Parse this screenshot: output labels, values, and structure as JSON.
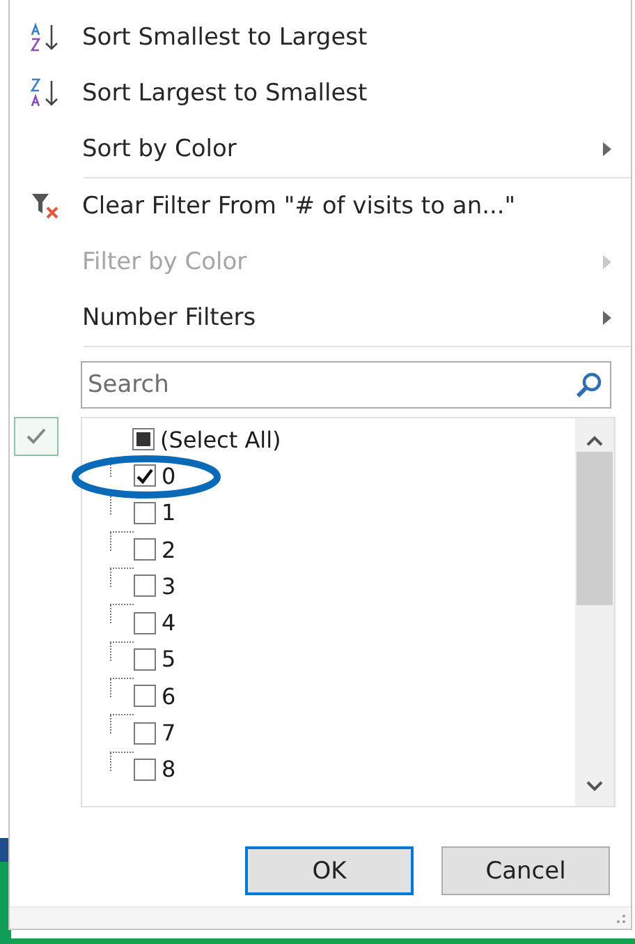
{
  "menu": [
    {
      "kind": "sort_asc",
      "label": "Sort Smallest to Largest",
      "disabled": false,
      "submenu": false
    },
    {
      "kind": "sort_desc",
      "label": "Sort Largest to Smallest",
      "disabled": false,
      "submenu": false
    },
    {
      "kind": "plain",
      "label": "Sort by Color",
      "disabled": false,
      "submenu": true,
      "separator_after": true
    },
    {
      "kind": "clear_filter",
      "label": "Clear Filter From \"# of visits to an...\"",
      "disabled": false,
      "submenu": false
    },
    {
      "kind": "plain",
      "label": "Filter by Color",
      "disabled": true,
      "submenu": true
    },
    {
      "kind": "plain",
      "label": "Number Filters",
      "disabled": false,
      "submenu": true,
      "separator_after": true
    }
  ],
  "search": {
    "placeholder": "Search"
  },
  "values": [
    {
      "label": "(Select All)",
      "checked": false,
      "indeterminate": true,
      "root": true
    },
    {
      "label": "0",
      "checked": true,
      "indeterminate": false
    },
    {
      "label": "1",
      "checked": false,
      "indeterminate": false
    },
    {
      "label": "2",
      "checked": false,
      "indeterminate": false
    },
    {
      "label": "3",
      "checked": false,
      "indeterminate": false
    },
    {
      "label": "4",
      "checked": false,
      "indeterminate": false
    },
    {
      "label": "5",
      "checked": false,
      "indeterminate": false
    },
    {
      "label": "6",
      "checked": false,
      "indeterminate": false
    },
    {
      "label": "7",
      "checked": false,
      "indeterminate": false
    },
    {
      "label": "8",
      "checked": false,
      "indeterminate": false
    }
  ],
  "buttons": [
    {
      "label": "OK",
      "default": true
    },
    {
      "label": "Cancel",
      "default": false
    }
  ]
}
